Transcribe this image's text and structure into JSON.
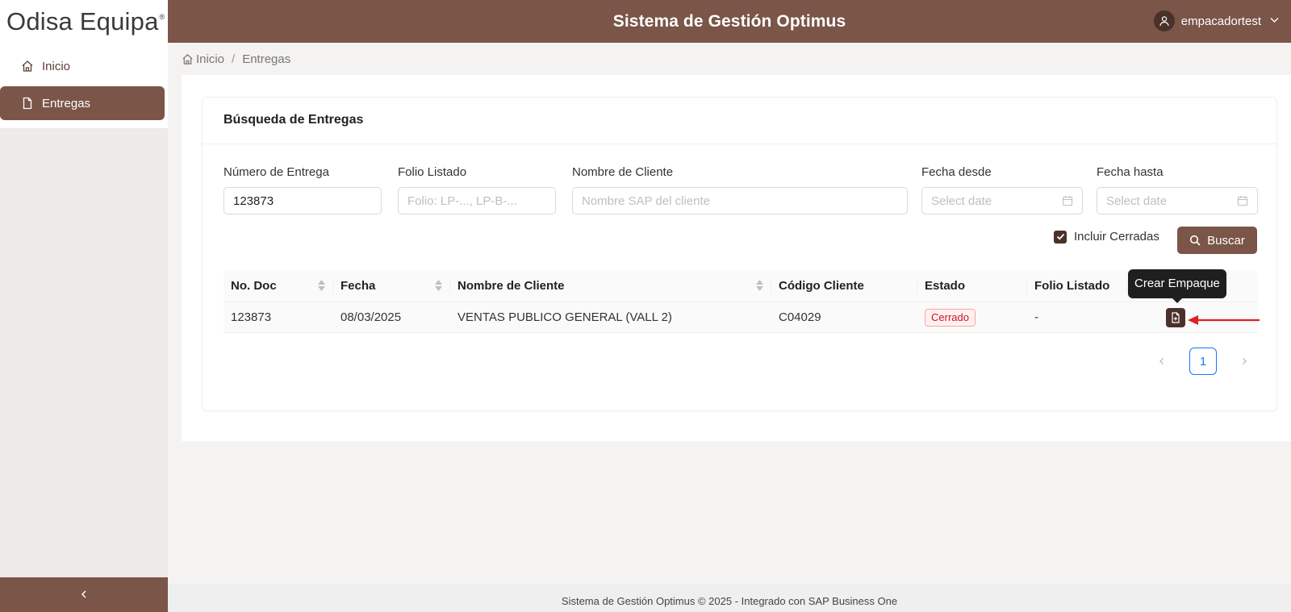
{
  "sidebar": {
    "logo": "Odisa Equipa",
    "logo_mark": "®",
    "items": [
      {
        "label": "Inicio",
        "icon": "home-icon"
      },
      {
        "label": "Entregas",
        "icon": "file-icon"
      }
    ],
    "collapse_glyph": "<"
  },
  "header": {
    "title": "Sistema de Gestión Optimus",
    "username": "empacadortest"
  },
  "breadcrumb": {
    "home": "Inicio",
    "separator": "/",
    "current": "Entregas"
  },
  "search": {
    "title": "Búsqueda de Entregas",
    "fields": {
      "numero_entrega": {
        "label": "Número de Entrega",
        "value": "123873"
      },
      "folio_listado": {
        "label": "Folio Listado",
        "placeholder": "Folio: LP-..., LP-B-..."
      },
      "nombre_cliente": {
        "label": "Nombre de Cliente",
        "placeholder": "Nombre SAP del cliente"
      },
      "fecha_desde": {
        "label": "Fecha desde",
        "placeholder": "Select date"
      },
      "fecha_hasta": {
        "label": "Fecha hasta",
        "placeholder": "Select date"
      }
    },
    "include_closed_label": "Incluir Cerradas",
    "include_closed_checked": true,
    "search_button": "Buscar"
  },
  "table": {
    "columns": [
      "No. Doc",
      "Fecha",
      "Nombre de Cliente",
      "Código Cliente",
      "Estado",
      "Folio Listado"
    ],
    "rows": [
      {
        "no_doc": "123873",
        "fecha": "08/03/2025",
        "cliente": "VENTAS PUBLICO GENERAL (VALL 2)",
        "codigo": "C04029",
        "estado": "Cerrado",
        "folio": "-"
      }
    ],
    "action_tooltip": "Crear Empaque"
  },
  "pagination": {
    "prev": "<",
    "current": "1",
    "next": ">"
  },
  "colors": {
    "brand": "#7a5548",
    "brand_dark": "#4a3129",
    "arrow": "#e02020",
    "link": "#1677ff"
  },
  "footer": "Sistema de Gestión Optimus © 2025 - Integrado con SAP Business One"
}
